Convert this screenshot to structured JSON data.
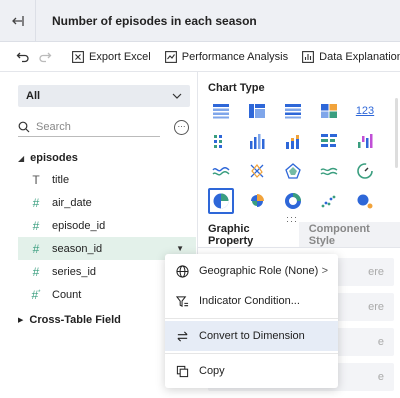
{
  "header": {
    "title": "Number of episodes in each season"
  },
  "toolbar": {
    "export_label": "Export Excel",
    "performance_label": "Performance Analysis",
    "explanation_label": "Data Explanation"
  },
  "left": {
    "dataset_select": "All",
    "search_placeholder": "Search",
    "table_name": "episodes",
    "fields": [
      {
        "name": "title",
        "type": "text"
      },
      {
        "name": "air_date",
        "type": "number"
      },
      {
        "name": "episode_id",
        "type": "number"
      },
      {
        "name": "season_id",
        "type": "number"
      },
      {
        "name": "series_id",
        "type": "number"
      },
      {
        "name": "Count",
        "type": "number"
      }
    ],
    "cross_table": "Cross-Table Field"
  },
  "right": {
    "chart_type_label": "Chart Type",
    "chart_types": [
      "table-icon",
      "crosstab-icon",
      "detail-table-icon",
      "combo-table-icon",
      "number-icon",
      "grouped-scatter-icon",
      "bar-icon",
      "stacked-bar-icon",
      "tree-bar-icon",
      "waterfall-icon",
      "line-icon",
      "radar-icon",
      "polygon-icon",
      "area-icon",
      "gauge-icon",
      "pie-icon",
      "rose-pie-icon",
      "donut-icon",
      "scatter-icon",
      "bubble-icon"
    ],
    "number_glyph": "123",
    "tab_graphic": "Graphic Property",
    "tab_component": "Component Style",
    "row_hints": [
      "ere",
      "ere",
      "e",
      "e"
    ]
  },
  "menu": {
    "geo_role": "Geographic Role  (None)",
    "indicator": "Indicator Condition...",
    "convert": "Convert to Dimension",
    "copy": "Copy"
  },
  "colors": {
    "accent": "#2e67d8",
    "measure": "#3a9e7f",
    "selected_row": "#e3f1ea",
    "menu_hover": "#e6ecf6"
  }
}
